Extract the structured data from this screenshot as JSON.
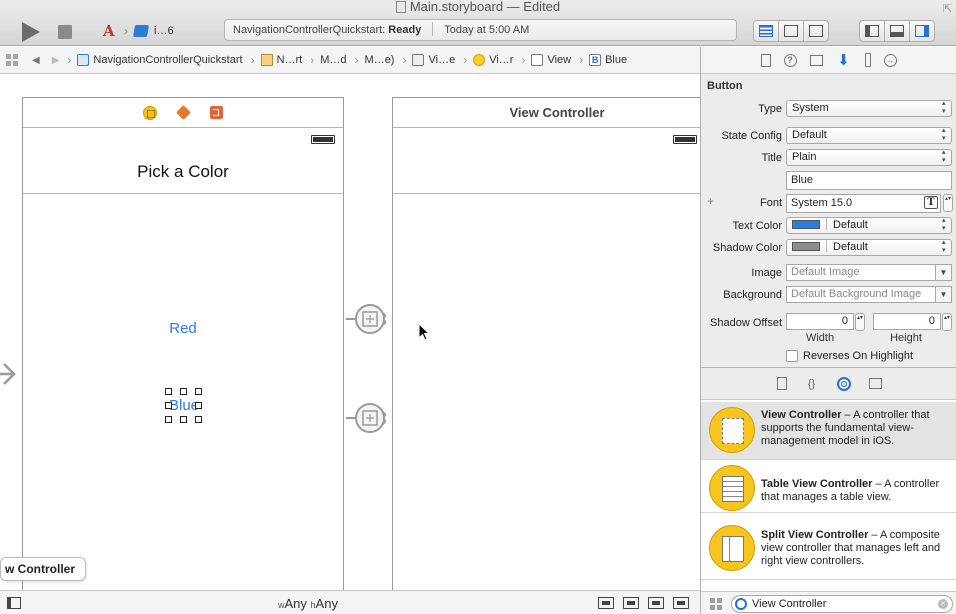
{
  "window": {
    "title": "Main.storyboard — Edited",
    "scheme_label": "i…6",
    "scheme_separator": "›",
    "activity_project": "NavigationControllerQuickstart:",
    "activity_status": "Ready",
    "activity_time": "Today at 5:00 AM",
    "close_glyph": "⇱"
  },
  "jumpbar": {
    "back": "◀",
    "forward": "▶",
    "separator": "›",
    "crumbs": [
      "NavigationControllerQuickstart",
      "N…rt",
      "M…d",
      "M…e)",
      "Vi…e",
      "Vi…r",
      "View",
      "Blue"
    ]
  },
  "canvas": {
    "scene1": {
      "nav_title": "Pick a Color",
      "button_red": "Red",
      "button_blue": "Blue"
    },
    "scene2": {
      "title": "View Controller"
    },
    "tooltip": "w Controller"
  },
  "bottombar": {
    "w_prefix": "w",
    "w_value": "Any",
    "h_prefix": "h",
    "h_value": "Any"
  },
  "inspector": {
    "section": "Button",
    "type_label": "Type",
    "type_value": "System",
    "state_label": "State Config",
    "state_value": "Default",
    "title_label": "Title",
    "title_mode": "Plain",
    "title_text": "Blue",
    "font_label": "Font",
    "font_value": "System 15.0",
    "font_glyph": "T",
    "text_color_label": "Text Color",
    "text_color_value": "Default",
    "text_color_hex": "#2a7be4",
    "shadow_color_label": "Shadow Color",
    "shadow_color_value": "Default",
    "shadow_color_hex": "#8c8c8c",
    "image_label": "Image",
    "image_placeholder": "Default Image",
    "background_label": "Background",
    "background_placeholder": "Default Background Image",
    "shadow_offset_label": "Shadow Offset",
    "width_value": "0",
    "height_value": "0",
    "width_label": "Width",
    "height_label": "Height",
    "reverses_label": "Reverses On Highlight",
    "plus_glyph": "+",
    "help_glyph": "?",
    "connections_glyph": "→",
    "lib_code_glyph": "{}",
    "combo_arrow": "▼"
  },
  "library": {
    "items": [
      {
        "name": "View Controller",
        "desc": " – A controller that supports the fundamental view-management model in iOS."
      },
      {
        "name": "Table View Controller",
        "desc": " – A controller that manages a table view."
      },
      {
        "name": "Split View Controller",
        "desc": " – A composite view controller that manages left and right view controllers."
      }
    ],
    "filter_value": "View Controller",
    "clear_glyph": "×"
  },
  "colors": {
    "accent": "#2a6fd6",
    "link": "#2a7be4",
    "object_icon": "#f7c51d"
  }
}
